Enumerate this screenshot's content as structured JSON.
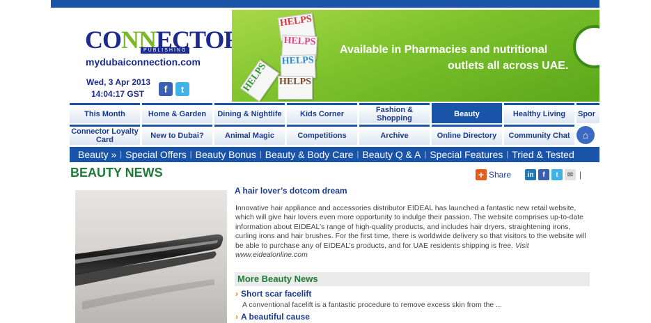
{
  "header": {
    "logo_main_a": "CO",
    "logo_main_b": "NN",
    "logo_main_c": "ECTOR",
    "logo_sub": "PUBLISHING",
    "site_url": "mydubaiconnection.com",
    "date": "Wed, 3 Apr 2013",
    "time": "14:04:17 GST",
    "social": [
      {
        "name": "facebook-icon",
        "glyph": "f"
      },
      {
        "name": "twitter-icon",
        "glyph": "t"
      }
    ]
  },
  "banner": {
    "line1": "Available in Pharmacies and nutritional",
    "line2": "outlets all across UAE.",
    "product_label": "HELPS",
    "colors": {
      "bg": "#7cc12c"
    }
  },
  "nav": {
    "row1": [
      "This Month",
      "Home & Garden",
      "Dining & Nightlife",
      "Kids Corner",
      "Fashion & Shopping",
      "Beauty",
      "Healthy Living",
      "Spor"
    ],
    "row2": [
      "Connector Loyalty Card",
      "New to Dubai?",
      "Animal Magic",
      "Competitions",
      "Archive",
      "Online Directory",
      "Community Chat"
    ],
    "active": "Beauty",
    "home_icon": "house-icon"
  },
  "subnav": {
    "items": [
      "Beauty »",
      "Special Offers",
      "Beauty Bonus",
      "Beauty & Body Care",
      "Beauty Q & A",
      "Special Features",
      "Tried & Tested"
    ]
  },
  "page": {
    "title": "BEAUTY NEWS",
    "share_label": "Share"
  },
  "article": {
    "title": "A hair lover’s dotcom dream",
    "body": "Innovative hair appliance and accessories distributor EIDEAL has launched a fantastic new retail website, which will give hair lovers even more opportunity to indulge their passion. The website comprises up-to-date information about EIDEAL’s range of high-quality products, and includes hair dryers, straightening irons, curling irons and hair brushes. For the first time, there is worldwide delivery so that visitors to the website will be able to purchase any of EIDEAL’s products, and for UAE residents shipping is free.",
    "visit": "Visit www.eidealonline.com"
  },
  "more_news": {
    "heading": "More Beauty News",
    "items": [
      {
        "title": "Short scar facelift",
        "desc": "A conventional facelift is a fantastic procedure to remove excess skin from the ..."
      },
      {
        "title": "A beautiful cause",
        "desc": ""
      }
    ]
  },
  "colors": {
    "brand_blue": "#1a54a8",
    "title_green": "#1f7a3a",
    "link_blue": "#1b3c8c"
  }
}
